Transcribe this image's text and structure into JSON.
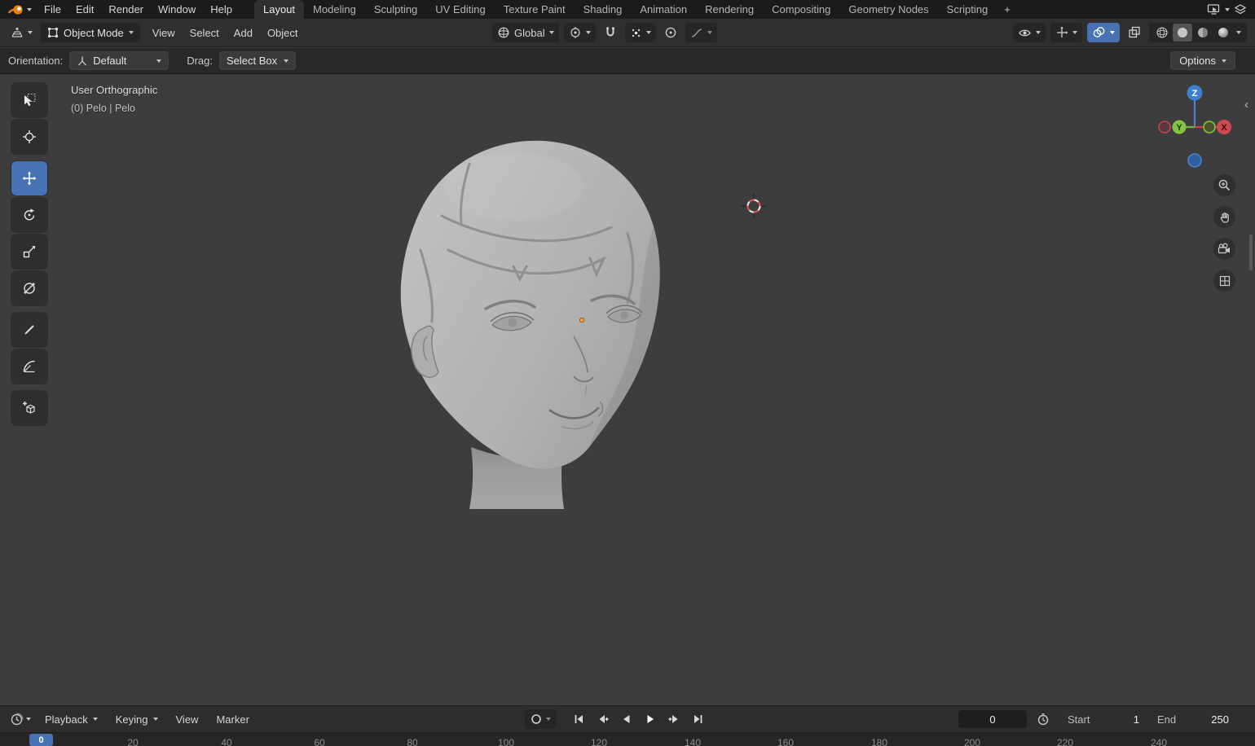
{
  "topbar": {
    "menus": [
      "File",
      "Edit",
      "Render",
      "Window",
      "Help"
    ],
    "tabs": [
      "Layout",
      "Modeling",
      "Sculpting",
      "UV Editing",
      "Texture Paint",
      "Shading",
      "Animation",
      "Rendering",
      "Compositing",
      "Geometry Nodes",
      "Scripting"
    ],
    "active_tab": "Layout",
    "add_tab_label": "+"
  },
  "viewport_header": {
    "mode": "Object Mode",
    "menus": [
      "View",
      "Select",
      "Add",
      "Object"
    ],
    "orientation": "Global"
  },
  "tool_settings": {
    "orientation_label": "Orientation:",
    "orientation_value": "Default",
    "drag_label": "Drag:",
    "drag_value": "Select Box",
    "options_label": "Options"
  },
  "viewport": {
    "view_label": "User Orthographic",
    "breadcrumb": "(0) Pelo | Pelo",
    "axis_x": "X",
    "axis_y": "Y",
    "axis_z": "Z"
  },
  "timeline": {
    "playback_label": "Playback",
    "keying_label": "Keying",
    "view_label": "View",
    "marker_label": "Marker",
    "current_frame": "0",
    "start_label": "Start",
    "start_value": "1",
    "end_label": "End",
    "end_value": "250",
    "playhead_frame": "0",
    "ruler_ticks": [
      "20",
      "40",
      "60",
      "80",
      "100",
      "120",
      "140",
      "160",
      "180",
      "200",
      "220",
      "240"
    ]
  },
  "colors": {
    "accent_blue": "#4772b3",
    "axis_x": "#cc4a50",
    "axis_y": "#84c441",
    "axis_z": "#3f7fd0",
    "origin_orange": "#ffa733",
    "viewport_bg": "#3d3d3d"
  }
}
